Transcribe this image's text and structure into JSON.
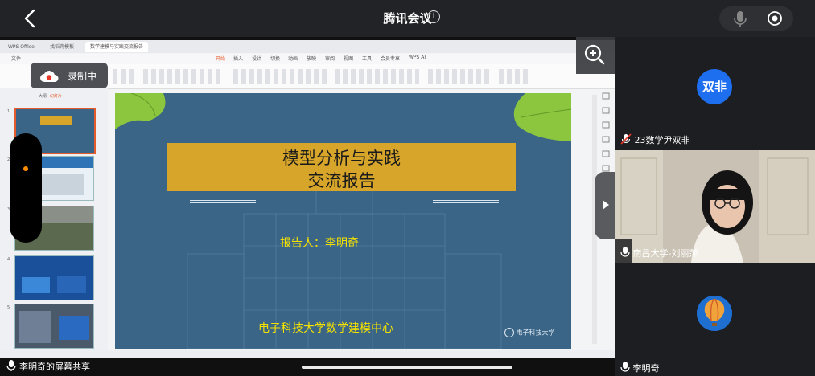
{
  "app": {
    "title": "腾讯会议",
    "info_icon": "i"
  },
  "recording": {
    "label": "录制中"
  },
  "share": {
    "label": "李明奇的屏幕共享"
  },
  "wps": {
    "tabs": [
      "WPS Office",
      "找稻壳模板",
      "数学建模与实践交流报告"
    ],
    "menu": [
      "文件",
      "开始",
      "插入",
      "设计",
      "切换",
      "动画",
      "放映",
      "审阅",
      "视图",
      "工具",
      "会员专享",
      "WPS AI"
    ],
    "panel_tabs": [
      "大纲",
      "幻灯片"
    ],
    "thumb_numbers": [
      "1",
      "2",
      "3",
      "4",
      "5"
    ]
  },
  "slide": {
    "title_line1": "模型分析与实践",
    "title_line2": "交流报告",
    "reporter": "报告人：李明奇",
    "organization": "电子科技大学数学建模中心",
    "logo_text": "电子科技大学"
  },
  "participants": [
    {
      "name": "23数学尹双非",
      "avatar_text": "双非",
      "avatar_color": "#1e6ef0"
    },
    {
      "name": "南昌大学-刘丽萍",
      "video": true
    },
    {
      "name": "李明奇",
      "avatar": "hot-air-balloon"
    }
  ],
  "colors": {
    "accent": "#1e6ef0",
    "slide_bg": "#3a6587",
    "title_box": "#d6a52a",
    "slide_text": "#f4e100"
  }
}
